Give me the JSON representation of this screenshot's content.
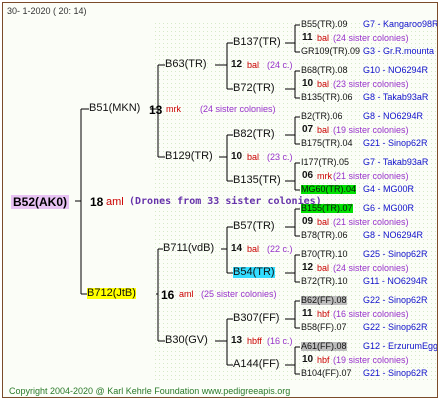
{
  "header": {
    "date": "30-   1-2020  ( 20:  14)"
  },
  "footer": {
    "copyright": "Copyright 2004-2020 @ Karl Kehrle Foundation    www.pedigreeapis.org"
  },
  "root": {
    "label": "B52(AK0)",
    "num": "18",
    "code": "aml",
    "note": "(Drones from 33 sister colonies)"
  },
  "gen1": [
    {
      "label": "B51(MKN)",
      "num": "13",
      "code": "mrk",
      "note": "(24 sister colonies)"
    },
    {
      "label": "B712(JtB)",
      "num": "16",
      "code": "aml",
      "note": "(25 sister colonies)"
    }
  ],
  "gen2": [
    {
      "label": "B63(TR)",
      "num": "12",
      "code": "bal",
      "note": "(24 c.)"
    },
    {
      "label": "B129(TR)",
      "num": "10",
      "code": "bal",
      "note": "(23 c.)"
    },
    {
      "label": "B711(vdB)",
      "num": "14",
      "code": "bal",
      "note": "(22 c.)"
    },
    {
      "label": "B30(GV)",
      "num": "13",
      "code": "hbff",
      "note": "(16 c.)"
    }
  ],
  "gen3": [
    {
      "label": "B137(TR)"
    },
    {
      "label": "B72(TR)"
    },
    {
      "label": "B82(TR)"
    },
    {
      "label": "B135(TR)"
    },
    {
      "label": "B57(TR)"
    },
    {
      "label": "B54(TR)"
    },
    {
      "label": "B307(FF)"
    },
    {
      "label": "A144(FF)"
    }
  ],
  "gen4": [
    {
      "mid": {
        "num": "11",
        "code": "bal",
        "note": "(24 sister colonies)"
      },
      "top": {
        "label": "B55(TR).09",
        "link": "G7 - Kangaroo98R"
      },
      "bot": {
        "label": "GR109(TR).09",
        "link": "G3 - Gr.R.mounta"
      }
    },
    {
      "mid": {
        "num": "10",
        "code": "bal",
        "note": "(23 sister colonies)"
      },
      "top": {
        "label": "B68(TR).08",
        "link": "G10 - NO6294R"
      },
      "bot": {
        "label": "B135(TR).06",
        "link": "G8 - Takab93aR"
      }
    },
    {
      "mid": {
        "num": "07",
        "code": "bal",
        "note": "(19 sister colonies)"
      },
      "top": {
        "label": "B2(TR).06",
        "link": "G8 - NO6294R"
      },
      "bot": {
        "label": "B175(TR).04",
        "link": "G21 - Sinop62R"
      }
    },
    {
      "mid": {
        "num": "06",
        "code": "mrk",
        "note": "(21 sister colonies)"
      },
      "top": {
        "label": "I177(TR).05",
        "link": "G7 - Takab93aR"
      },
      "bot": {
        "label": "MG60(TR).04",
        "link": "G4 - MG00R"
      }
    },
    {
      "mid": {
        "num": "09",
        "code": "bal",
        "note": "(21 sister colonies)"
      },
      "top": {
        "label": "B155(TR).07",
        "link": "G6 - MG00R"
      },
      "bot": {
        "label": "B78(TR).06",
        "link": "G8 - NO6294R"
      }
    },
    {
      "mid": {
        "num": "12",
        "code": "bal",
        "note": "(24 sister colonies)"
      },
      "top": {
        "label": "B70(TR).10",
        "link": "G25 - Sinop62R"
      },
      "bot": {
        "label": "B72(TR).10",
        "link": "G11 - NO6294R"
      }
    },
    {
      "mid": {
        "num": "11",
        "code": "hbf",
        "note": "(16 sister colonies)"
      },
      "top": {
        "label": "B62(FF).08",
        "link": "G22 - Sinop62R"
      },
      "bot": {
        "label": "B58(FF).07",
        "link": "G22 - Sinop62R"
      }
    },
    {
      "mid": {
        "num": "10",
        "code": "hbf",
        "note": "(19 sister colonies)"
      },
      "top": {
        "label": "A61(FF).08",
        "link": "G12 - ErzurumEgg8"
      },
      "bot": {
        "label": "B104(FF).07",
        "link": "G21 - Sinop62R"
      }
    }
  ]
}
